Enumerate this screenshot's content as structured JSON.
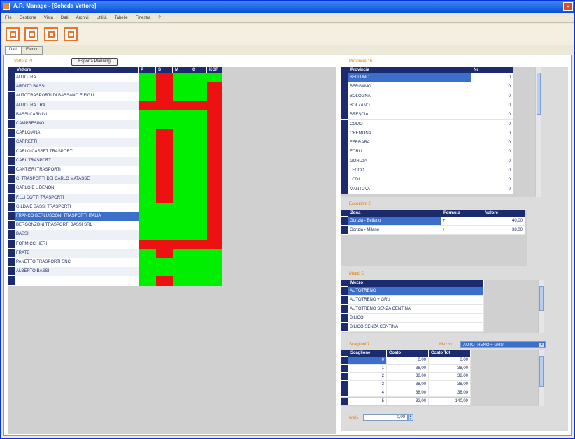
{
  "window": {
    "title": "A.R. Manage - [Scheda Vettore]",
    "close_glyph": "×"
  },
  "menu": [
    "File",
    "Gestione",
    "Vista",
    "Dati",
    "Archivi",
    "Utilità",
    "Tabelle",
    "Finestra",
    "?"
  ],
  "toolbar": {
    "buttons": [
      "new-icon",
      "edit-icon",
      "save-icon",
      "list-icon"
    ]
  },
  "tabs": [
    "Dati",
    "Elenco"
  ],
  "left": {
    "section_label": "Vettore 21",
    "button_label": "Esporta Planning",
    "columns": [
      "Vettore",
      "P",
      "S",
      "M",
      "C",
      "KGF"
    ],
    "rows": [
      "AUTOTRA",
      "ARDITO BASSI",
      "AUTOTRASPORTI DI BASSANO E FIGLI",
      "AUTOTRA TRA",
      "BASSI CARNINI",
      "CAMPRESINO",
      "CARLO ANA",
      "CARRETTI",
      "CARLO CASSET TRASPORTI",
      "CARL TRASPORT",
      "CANTIERI TRASPORTI",
      "C. TRASPORTI DEI CARLO MATASSE",
      "CARLO E L DENONI",
      "F.LLI DOTTI TRASPORTI",
      "GILDA E BASSI TRASPORTI",
      "FRANCO BERLUSCONI TRASPORTI ITALIA",
      "BERGONZONI TRASPORTI BASSI SRL",
      "BASSI",
      "FORMICCHIERI",
      "FRATE",
      "PANETTO TRASPORTI SNC",
      "ALBERTO BASSI"
    ],
    "selected_row": 15,
    "status_colors": {
      "ok": "#00ee00",
      "ko": "#ee1111"
    },
    "status_matrix": [
      [
        "g",
        "r",
        "g",
        "g",
        "g"
      ],
      [
        "g",
        "r",
        "g",
        "g",
        "r"
      ],
      [
        "g",
        "r",
        "g",
        "g",
        "r"
      ],
      [
        "r",
        "r",
        "r",
        "r",
        "r"
      ],
      [
        "g",
        "g",
        "g",
        "g",
        "r"
      ],
      [
        "g",
        "g",
        "g",
        "g",
        "r"
      ],
      [
        "g",
        "r",
        "g",
        "g",
        "r"
      ],
      [
        "g",
        "r",
        "g",
        "g",
        "r"
      ],
      [
        "g",
        "r",
        "g",
        "g",
        "r"
      ],
      [
        "g",
        "r",
        "g",
        "g",
        "r"
      ],
      [
        "g",
        "r",
        "g",
        "g",
        "r"
      ],
      [
        "g",
        "r",
        "g",
        "g",
        "r"
      ],
      [
        "g",
        "r",
        "g",
        "g",
        "r"
      ],
      [
        "g",
        "r",
        "g",
        "g",
        "r"
      ],
      [
        "g",
        "g",
        "g",
        "g",
        "r"
      ],
      [
        "g",
        "g",
        "g",
        "g",
        "r"
      ],
      [
        "g",
        "g",
        "g",
        "g",
        "r"
      ],
      [
        "g",
        "g",
        "g",
        "g",
        "r"
      ],
      [
        "r",
        "r",
        "r",
        "r",
        "r"
      ],
      [
        "g",
        "r",
        "g",
        "g",
        "g"
      ],
      [
        "g",
        "g",
        "g",
        "g",
        "g"
      ],
      [
        "g",
        "g",
        "g",
        "g",
        "g"
      ],
      [
        "g",
        "r",
        "g",
        "g",
        "g"
      ]
    ]
  },
  "provinces": {
    "section_label": "Provincie 16",
    "columns": [
      "Provincia",
      "Nr"
    ],
    "rows": [
      {
        "name": "BELLUNO",
        "nr": "0"
      },
      {
        "name": "BERGAMO",
        "nr": "0"
      },
      {
        "name": "BOLOGNA",
        "nr": "0"
      },
      {
        "name": "BOLZANO",
        "nr": "0"
      },
      {
        "name": "BRESCIA",
        "nr": "0"
      },
      {
        "name": "COMO",
        "nr": "0"
      },
      {
        "name": "CREMONA",
        "nr": "0"
      },
      {
        "name": "FERRARA",
        "nr": "0"
      },
      {
        "name": "FORLI",
        "nr": "0"
      },
      {
        "name": "GORIZIA",
        "nr": "0"
      },
      {
        "name": "LECCO",
        "nr": "0"
      },
      {
        "name": "LODI",
        "nr": "0"
      },
      {
        "name": "MANTOVA",
        "nr": "0"
      }
    ],
    "selected_row": 0
  },
  "zones": {
    "section_label": "Eccezioni 2",
    "columns": [
      "Zona",
      "Formula",
      "Valore"
    ],
    "rows": [
      {
        "zona": "Gorizia - Belluno",
        "formula": "+",
        "valore": "40,00"
      },
      {
        "zona": "Gorizia - Milano",
        "formula": "+",
        "valore": "38,00"
      }
    ],
    "selected_row": 0
  },
  "mezzi": {
    "section_label": "Mezzi 5",
    "columns": [
      "Mezzo"
    ],
    "rows": [
      "AUTOTRENO",
      "AUTOTRENO + GRU",
      "AUTOTRENO SENZA CENTINA",
      "BILICO",
      "BILICO SENZA CENTINA"
    ],
    "selected_row": 0
  },
  "scaglioni": {
    "section_label": "Scaglioni 7",
    "mezzo_label": "Mezzo",
    "mezzo_value": "AUTOTRENO + GRU",
    "columns": [
      "Scaglione",
      "Costo",
      "Costo Tot"
    ],
    "rows": [
      {
        "s": "0",
        "c": "0,00",
        "t": "0,00"
      },
      {
        "s": "1",
        "c": "38,00",
        "t": "38,00"
      },
      {
        "s": "2",
        "c": "38,00",
        "t": "38,00"
      },
      {
        "s": "3",
        "c": "38,00",
        "t": "38,00"
      },
      {
        "s": "4",
        "c": "38,00",
        "t": "38,00"
      },
      {
        "s": "5",
        "c": "32,00",
        "t": "140,00"
      }
    ],
    "selected_row": 0
  },
  "footer": {
    "label": "Iva%",
    "value": "0,00"
  }
}
